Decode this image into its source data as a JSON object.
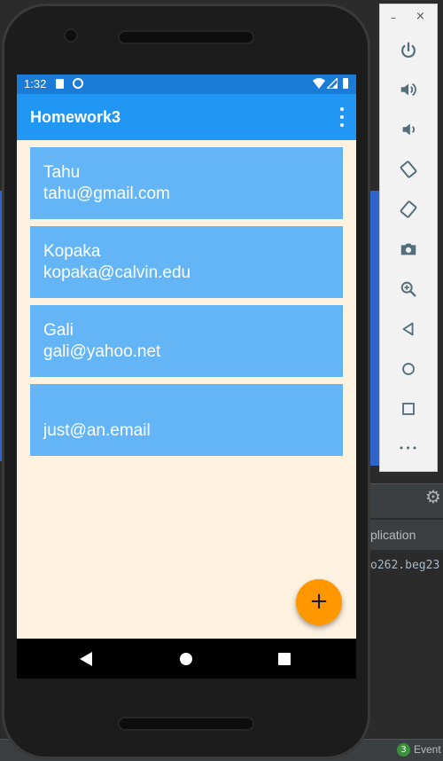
{
  "status_bar": {
    "time": "1:32"
  },
  "app_bar": {
    "title": "Homework3"
  },
  "contacts": [
    {
      "name": "Tahu",
      "email": "tahu@gmail.com"
    },
    {
      "name": "Kopaka",
      "email": "kopaka@calvin.edu"
    },
    {
      "name": "Gali",
      "email": "gali@yahoo.net"
    },
    {
      "name": "",
      "email": "just@an.email"
    }
  ],
  "fab": {
    "label": "+"
  },
  "emulator": {
    "minimize_label": "–",
    "close_label": "×",
    "more_label": "•••"
  },
  "ide": {
    "tab_text": "plication",
    "code_text": "o262.beg23",
    "event_badge": "3",
    "event_label": "Event"
  },
  "colors": {
    "status_bar": "#1a7cd6",
    "app_bar": "#2196f3",
    "card": "#64b5f6",
    "screen_bg": "#fdf2e0",
    "fab": "#ff9800"
  }
}
